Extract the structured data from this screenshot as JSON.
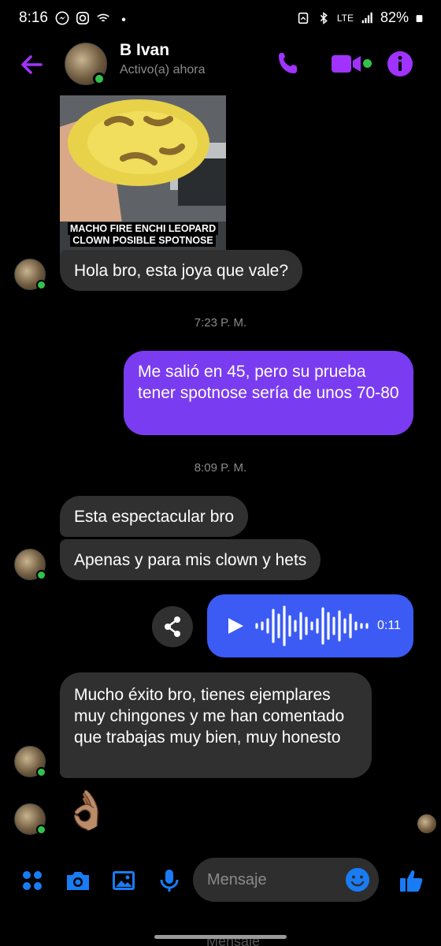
{
  "status_bar": {
    "time": "8:16",
    "network": "LTE",
    "battery": "82%"
  },
  "header": {
    "contact_name": "B Ivan",
    "contact_status": "Activo(a) ahora"
  },
  "messages": {
    "image_caption_line1": "MACHO FIRE ENCHI LEOPARD",
    "image_caption_line2": "CLOWN POSIBLE SPOTNOSE",
    "msg1": "Hola bro, esta joya que vale?",
    "time1": "7:23 P. M.",
    "msg2": "Me salió en 45, pero su prueba tener spotnose sería de unos 70-80",
    "time2": "8:09 P. M.",
    "msg3": "Esta espectacular bro",
    "msg4": "Apenas y para mis clown y hets",
    "audio_duration": "0:11",
    "msg5": "Mucho éxito bro, tienes ejemplares muy chingones y me han comentado que trabajas muy bien, muy honesto",
    "msg6": "👌🏽"
  },
  "composer": {
    "placeholder": "Mensaje"
  },
  "colors": {
    "accent": "#a033ff",
    "outgoing_bubble": "#7a3cf0",
    "incoming_bubble": "#303030",
    "audio_bubble": "#3b5bf4",
    "composer_icon": "#1a7cf5",
    "online": "#31c24d"
  }
}
